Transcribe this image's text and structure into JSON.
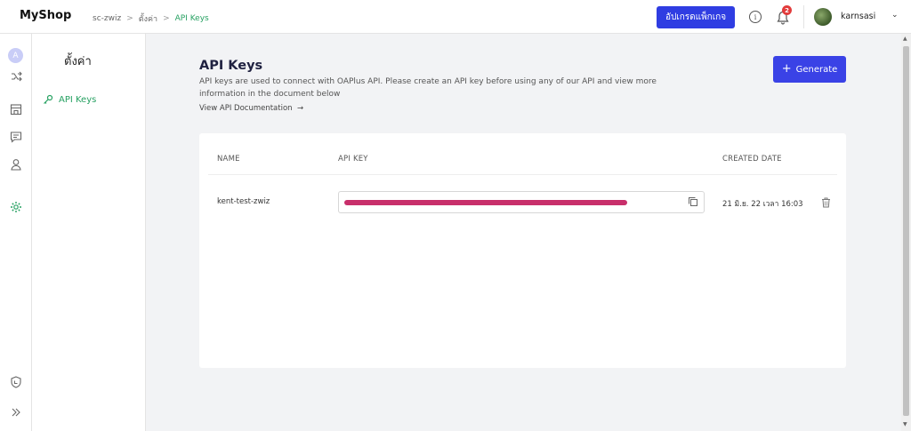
{
  "app": {
    "logo": "MyShop"
  },
  "breadcrumb": {
    "items": [
      "sc-zwiz",
      "ตั้งค่า",
      "API Keys"
    ]
  },
  "header": {
    "upgrade_label": "อัปเกรดแพ็กเกจ",
    "notification_count": "2",
    "username": "karnsasi"
  },
  "rail": {
    "avatar_letter": "A"
  },
  "sidebar": {
    "title": "ตั้งค่า",
    "items": [
      {
        "label": "API Keys",
        "icon": "key-icon"
      }
    ]
  },
  "main": {
    "title": "API Keys",
    "description": "API keys are used to connect with OAPlus API. Please create an API key before using any of our API and view more information in the document below",
    "doc_link": "View API Documentation",
    "generate_label": "Generate",
    "table": {
      "headers": [
        "NAME",
        "API KEY",
        "CREATED DATE"
      ],
      "rows": [
        {
          "name": "kent-test-zwiz",
          "created": "21 มิ.ย. 22 เวลา 16:03"
        }
      ]
    }
  },
  "colors": {
    "accent": "#3a42e6",
    "active_green": "#27a162",
    "redaction": "#c2185b"
  }
}
